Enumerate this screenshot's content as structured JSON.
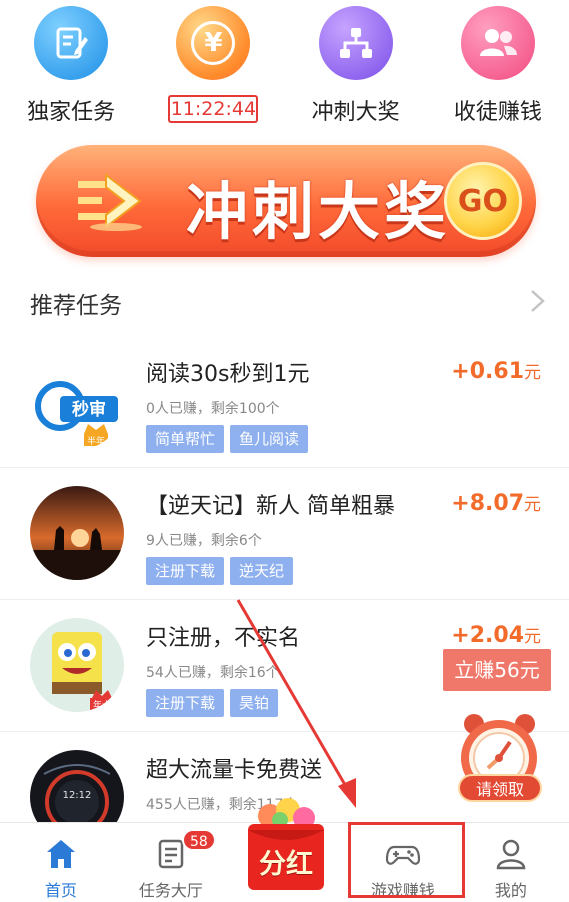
{
  "icon_grid": [
    {
      "label": "独家任务",
      "icon": "edit-note-icon"
    },
    {
      "timer": "11:22:44",
      "icon": "yen-coin-icon"
    },
    {
      "label": "冲刺大奖",
      "icon": "org-tree-icon"
    },
    {
      "label": "收徒赚钱",
      "icon": "users-icon"
    }
  ],
  "banner": {
    "title": "冲刺大奖",
    "go": "GO",
    "colors": {
      "start": "#ffb27a",
      "end": "#f24a2a"
    }
  },
  "section": {
    "title": "推荐任务"
  },
  "tasks": [
    {
      "title": "阅读30s秒到1元",
      "meta": "0人已赚，剩余100个",
      "tags": [
        "简单帮忙",
        "鱼儿阅读"
      ],
      "reward": "+0.61",
      "unit": "元",
      "thumb_text": "秒审",
      "thumb_badge": "半年"
    },
    {
      "title": "【逆天记】新人 简单粗暴",
      "meta": "9人已赚，剩余6个",
      "tags": [
        "注册下载",
        "逆天纪"
      ],
      "reward": "+8.07",
      "unit": "元"
    },
    {
      "title": "只注册，不实名",
      "meta": "54人已赚，剩余16个",
      "tags": [
        "注册下载",
        "昊铂"
      ],
      "reward": "+2.04",
      "unit": "元",
      "thumb_badge": "年卡"
    },
    {
      "title": "超大流量卡免费送",
      "meta": "455人已赚，剩余117个",
      "tags": [],
      "reward": "",
      "unit": "",
      "thumb_text": "12:12"
    }
  ],
  "floating": {
    "instant_earn": "立赚56元",
    "claim": "请领取"
  },
  "tab_bar": {
    "home": "首页",
    "tasks": "任务大厅",
    "tasks_badge": "58",
    "dividend": "分红",
    "games": "游戏赚钱",
    "me": "我的"
  },
  "colors": {
    "accent": "#2a7ad6",
    "reward": "#f26b2a",
    "tag": "#8fb0ee",
    "alert": "#e53935"
  }
}
